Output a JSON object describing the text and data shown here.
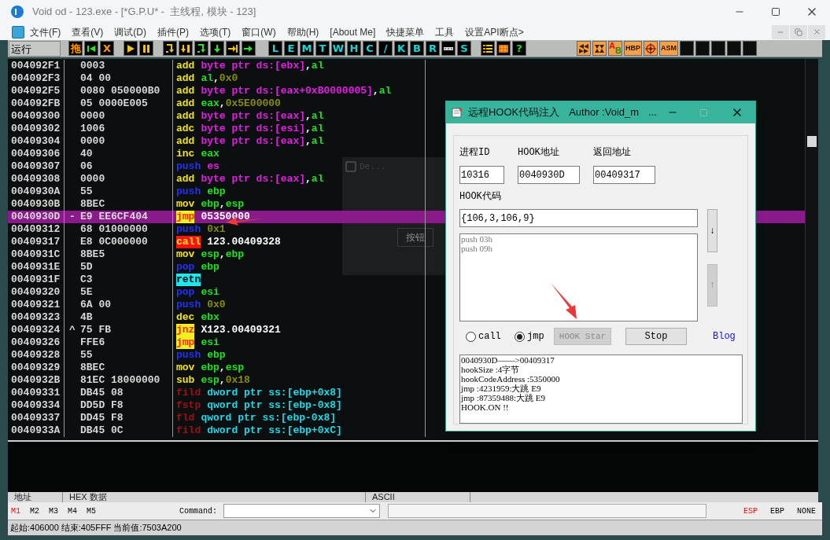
{
  "window": {
    "title": "Void od - 123.exe - [*G.P.U* -  主线程, 模块 - 123]"
  },
  "menu": [
    "文件(F)",
    "查看(V)",
    "调试(D)",
    "插件(P)",
    "选项(T)",
    "窗口(W)",
    "帮助(H)",
    "[About Me]",
    "快捷菜单",
    "工具",
    "设置API断点>"
  ],
  "toolbar": {
    "status": "运行",
    "groups": [
      [
        {
          "kind": "hot-key",
          "label": "拖"
        },
        {
          "kind": "icon"
        },
        {
          "kind": "hot-key",
          "label": "X"
        }
      ],
      [
        {
          "kind": "icon"
        },
        {
          "kind": "icon"
        }
      ],
      [
        {
          "kind": "icon"
        },
        {
          "kind": "icon"
        },
        {
          "kind": "icon"
        },
        {
          "kind": "icon"
        },
        {
          "kind": "icon"
        },
        {
          "kind": "icon"
        }
      ],
      [
        {
          "kind": "key",
          "label": "L"
        },
        {
          "kind": "key",
          "label": "E"
        },
        {
          "kind": "key",
          "label": "M"
        },
        {
          "kind": "key",
          "label": "T"
        },
        {
          "kind": "key",
          "label": "W"
        },
        {
          "kind": "key",
          "label": "H"
        },
        {
          "kind": "key",
          "label": "C"
        },
        {
          "kind": "key",
          "label": "/"
        },
        {
          "kind": "key",
          "label": "K"
        },
        {
          "kind": "key",
          "label": "B"
        },
        {
          "kind": "key",
          "label": "R"
        },
        {
          "kind": "icon"
        },
        {
          "kind": "key",
          "label": "S"
        }
      ],
      [
        {
          "kind": "icon"
        },
        {
          "kind": "icon"
        },
        {
          "kind": "help-key",
          "label": "?"
        }
      ],
      [
        {
          "kind": "tool-icon"
        },
        {
          "kind": "tool-icon"
        },
        {
          "kind": "pair",
          "labels": [
            "A",
            "B"
          ]
        },
        {
          "kind": "tag",
          "label": "HBP"
        },
        {
          "kind": "tool-icon"
        },
        {
          "kind": "tag",
          "label": "ASM"
        },
        {
          "kind": "blank"
        },
        {
          "kind": "blank"
        },
        {
          "kind": "blank"
        },
        {
          "kind": "blank"
        },
        {
          "kind": "blank"
        }
      ]
    ]
  },
  "disassembly": {
    "rows": [
      {
        "addr": "004092F1",
        "hex": "0003",
        "ins": [
          {
            "kind": "mn",
            "text": "add"
          },
          {
            "kind": "mem",
            "text": "byte ptr ds:[ebx]"
          },
          {
            "kind": "punct",
            "text": ","
          },
          {
            "kind": "reg",
            "text": "al"
          }
        ],
        "selected": false
      },
      {
        "addr": "004092F3",
        "hex": "04 00",
        "ins": [
          {
            "kind": "mn",
            "text": "add"
          },
          {
            "kind": "reg",
            "text": "al"
          },
          {
            "kind": "punct",
            "text": ","
          },
          {
            "kind": "num",
            "text": "0x0"
          }
        ],
        "selected": false
      },
      {
        "addr": "004092F5",
        "hex": "0080 050000B0",
        "ins": [
          {
            "kind": "mn",
            "text": "add"
          },
          {
            "kind": "mem",
            "text": "byte ptr ds:[eax+0xB0000005]"
          },
          {
            "kind": "punct",
            "text": ","
          },
          {
            "kind": "reg",
            "text": "al"
          }
        ],
        "selected": false
      },
      {
        "addr": "004092FB",
        "hex": "05 0000E005",
        "ins": [
          {
            "kind": "mn",
            "text": "add"
          },
          {
            "kind": "reg",
            "text": "eax"
          },
          {
            "kind": "punct",
            "text": ","
          },
          {
            "kind": "num",
            "text": "0x5E00000"
          }
        ],
        "selected": false
      },
      {
        "addr": "00409300",
        "hex": "0000",
        "ins": [
          {
            "kind": "mn",
            "text": "add"
          },
          {
            "kind": "mem",
            "text": "byte ptr ds:[eax]"
          },
          {
            "kind": "punct",
            "text": ","
          },
          {
            "kind": "reg",
            "text": "al"
          }
        ],
        "selected": false
      },
      {
        "addr": "00409302",
        "hex": "1006",
        "ins": [
          {
            "kind": "mn",
            "text": "adc"
          },
          {
            "kind": "mem",
            "text": "byte ptr ds:[esi]"
          },
          {
            "kind": "punct",
            "text": ","
          },
          {
            "kind": "reg",
            "text": "al"
          }
        ],
        "selected": false
      },
      {
        "addr": "00409304",
        "hex": "0000",
        "ins": [
          {
            "kind": "mn",
            "text": "add"
          },
          {
            "kind": "mem",
            "text": "byte ptr ds:[eax]"
          },
          {
            "kind": "punct",
            "text": ","
          },
          {
            "kind": "reg",
            "text": "al"
          }
        ],
        "selected": false
      },
      {
        "addr": "00409306",
        "hex": "40",
        "ins": [
          {
            "kind": "mn",
            "text": "inc"
          },
          {
            "kind": "reg",
            "text": "eax"
          }
        ],
        "selected": false
      },
      {
        "addr": "00409307",
        "hex": "06",
        "ins": [
          {
            "kind": "stack",
            "text": "push"
          },
          {
            "kind": "mem",
            "text": "es"
          }
        ],
        "selected": false
      },
      {
        "addr": "00409308",
        "hex": "0000",
        "ins": [
          {
            "kind": "mn",
            "text": "add"
          },
          {
            "kind": "mem",
            "text": "byte ptr ds:[eax]"
          },
          {
            "kind": "punct",
            "text": ","
          },
          {
            "kind": "reg",
            "text": "al"
          }
        ],
        "selected": false
      },
      {
        "addr": "0040930A",
        "hex": "55",
        "ins": [
          {
            "kind": "stack",
            "text": "push"
          },
          {
            "kind": "reg",
            "text": "ebp"
          }
        ],
        "selected": false
      },
      {
        "addr": "0040930B",
        "hex": "8BEC",
        "ins": [
          {
            "kind": "mn",
            "text": "mov"
          },
          {
            "kind": "reg",
            "text": "ebp"
          },
          {
            "kind": "punct",
            "text": ","
          },
          {
            "kind": "reg",
            "text": "esp"
          }
        ],
        "selected": false
      },
      {
        "addr": "0040930D",
        "mark": "-",
        "hex": "E9 EE6CF404",
        "ins": [
          {
            "kind": "jump",
            "text": "jmp"
          },
          {
            "kind": "addr",
            "text": "05350000"
          }
        ],
        "selected": true
      },
      {
        "addr": "00409312",
        "hex": "68 01000000",
        "ins": [
          {
            "kind": "stack",
            "text": "push"
          },
          {
            "kind": "num",
            "text": "0x1"
          }
        ],
        "selected": false
      },
      {
        "addr": "00409317",
        "hex": "E8 0C000000",
        "ins": [
          {
            "kind": "call",
            "text": "call"
          },
          {
            "kind": "addr",
            "text": "123.00409328"
          }
        ],
        "selected": false
      },
      {
        "addr": "0040931C",
        "hex": "8BE5",
        "ins": [
          {
            "kind": "mn",
            "text": "mov"
          },
          {
            "kind": "reg",
            "text": "esp"
          },
          {
            "kind": "punct",
            "text": ","
          },
          {
            "kind": "reg",
            "text": "ebp"
          }
        ],
        "selected": false
      },
      {
        "addr": "0040931E",
        "hex": "5D",
        "ins": [
          {
            "kind": "stack",
            "text": "pop"
          },
          {
            "kind": "reg",
            "text": "ebp"
          }
        ],
        "selected": false
      },
      {
        "addr": "0040931F",
        "hex": "C3",
        "ins": [
          {
            "kind": "ret",
            "text": "retn"
          }
        ],
        "selected": false
      },
      {
        "addr": "00409320",
        "hex": "5E",
        "ins": [
          {
            "kind": "stack",
            "text": "pop"
          },
          {
            "kind": "reg",
            "text": "esi"
          }
        ],
        "selected": false
      },
      {
        "addr": "00409321",
        "hex": "6A 00",
        "ins": [
          {
            "kind": "stack",
            "text": "push"
          },
          {
            "kind": "num",
            "text": "0x0"
          }
        ],
        "selected": false
      },
      {
        "addr": "00409323",
        "hex": "4B",
        "ins": [
          {
            "kind": "mn",
            "text": "dec"
          },
          {
            "kind": "reg",
            "text": "ebx"
          }
        ],
        "selected": false
      },
      {
        "addr": "00409324",
        "mark": "^",
        "hex": "75 FB",
        "ins": [
          {
            "kind": "jump",
            "text": "jnz"
          },
          {
            "kind": "addr",
            "text": "X123.00409321"
          }
        ],
        "selected": false
      },
      {
        "addr": "00409326",
        "hex": "FFE6",
        "ins": [
          {
            "kind": "jump",
            "text": "jmp"
          },
          {
            "kind": "reg",
            "text": "esi"
          }
        ],
        "selected": false
      },
      {
        "addr": "00409328",
        "hex": "55",
        "ins": [
          {
            "kind": "stack",
            "text": "push"
          },
          {
            "kind": "reg",
            "text": "ebp"
          }
        ],
        "selected": false
      },
      {
        "addr": "00409329",
        "hex": "8BEC",
        "ins": [
          {
            "kind": "mn",
            "text": "mov"
          },
          {
            "kind": "reg",
            "text": "ebp"
          },
          {
            "kind": "punct",
            "text": ","
          },
          {
            "kind": "reg",
            "text": "esp"
          }
        ],
        "selected": false
      },
      {
        "addr": "0040932B",
        "hex": "81EC 18000000",
        "ins": [
          {
            "kind": "mn",
            "text": "sub"
          },
          {
            "kind": "reg",
            "text": "esp"
          },
          {
            "kind": "punct",
            "text": ","
          },
          {
            "kind": "num",
            "text": "0x18"
          }
        ],
        "selected": false
      },
      {
        "addr": "00409331",
        "hex": "DB45 08",
        "ins": [
          {
            "kind": "fpu",
            "text": "fild"
          },
          {
            "kind": "fmem",
            "text": "dword ptr ss:[ebp+0x8]"
          }
        ],
        "selected": false
      },
      {
        "addr": "00409334",
        "hex": "DD5D F8",
        "ins": [
          {
            "kind": "fpu",
            "text": "fstp"
          },
          {
            "kind": "fmem",
            "text": "qword ptr ss:[ebp-0x8]"
          }
        ],
        "selected": false
      },
      {
        "addr": "00409337",
        "hex": "DD45 F8",
        "ins": [
          {
            "kind": "fpu",
            "text": "fld"
          },
          {
            "kind": "fmem",
            "text": "qword ptr ss:[ebp-0x8]"
          }
        ],
        "selected": false
      },
      {
        "addr": "0040933A",
        "hex": "DB45 0C",
        "ins": [
          {
            "kind": "fpu",
            "text": "fild"
          },
          {
            "kind": "fmem",
            "text": "dword ptr ss:[ebp+0xC]"
          }
        ],
        "selected": false
      }
    ]
  },
  "background_window": {
    "title": "De...",
    "button": "按钮"
  },
  "hook_dialog": {
    "title": "远程HOOK代码注入",
    "author": "Author :Void_m",
    "ellipsis": "...",
    "fields": [
      {
        "label": "进程ID",
        "value": "10316"
      },
      {
        "label": "HOOK地址",
        "value": "0040930D"
      },
      {
        "label": "返回地址",
        "value": "00409317"
      }
    ],
    "code_label": "HOOK代码",
    "code_input": "{106,3,106,9}",
    "asm_lines": [
      "push 03h",
      "push 09h"
    ],
    "down_button": {
      "label": "↓",
      "disabled": false
    },
    "up_button": {
      "label": "↑",
      "disabled": true
    },
    "modes": [
      {
        "label": "call",
        "selected": false
      },
      {
        "label": "jmp",
        "selected": true
      }
    ],
    "start_button": {
      "label": "HOOK Star",
      "disabled": true
    },
    "stop_button": {
      "label": "Stop",
      "disabled": false
    },
    "blog_link": "Blog",
    "log": [
      "0040930D——>00409317",
      "hookSize :4字节",
      "hookCodeAddress :5350000",
      "jmp :4231959:大跳 E9",
      "jmp :87359488:大跳 E9",
      "HOOK.ON !!"
    ]
  },
  "dump": {
    "columns": [
      "地址",
      "HEX 数据",
      "ASCII"
    ]
  },
  "command_bar": {
    "marks": [
      {
        "label": "M1",
        "selected": true
      },
      {
        "label": "M2",
        "selected": false
      },
      {
        "label": "M3",
        "selected": false
      },
      {
        "label": "M4",
        "selected": false
      },
      {
        "label": "M5",
        "selected": false
      }
    ],
    "command_label": "Command:",
    "registers": [
      {
        "label": "ESP",
        "selected": true
      },
      {
        "label": "EBP",
        "selected": false
      },
      {
        "label": "NONE",
        "selected": false
      }
    ]
  },
  "status_bar": "起始:406000 结束:405FFF 当前值:7503A200"
}
